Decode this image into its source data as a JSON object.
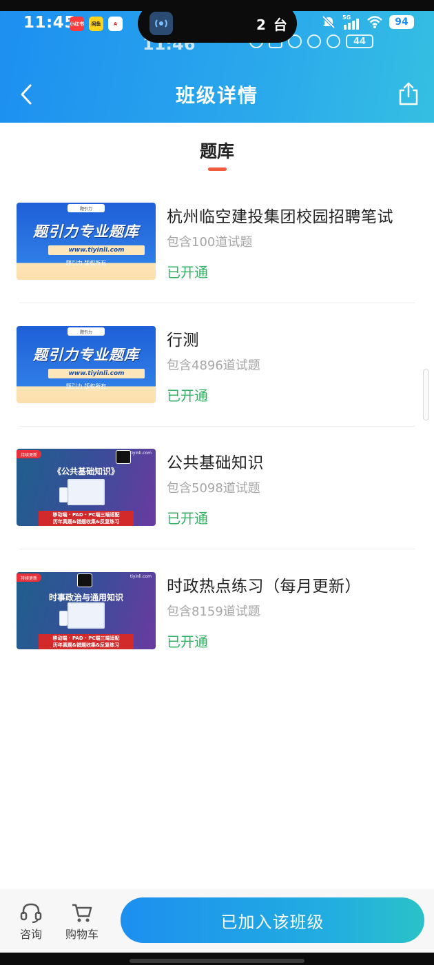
{
  "status_bar": {
    "time": "11:45",
    "app_icons": [
      "小红书",
      "闲鱼",
      "A"
    ],
    "island_count": "2 台",
    "network": "5G",
    "battery": "94",
    "ghost_time": "11:46",
    "ghost_battery": "44"
  },
  "header": {
    "title": "班级详情",
    "back_icon": "chevron-left-icon",
    "share_icon": "share-icon"
  },
  "tab": {
    "label": "题库"
  },
  "banks": [
    {
      "title": "杭州临空建投集团校园招聘笔试",
      "count": "包含100道试题",
      "status": "已开通",
      "thumb": {
        "style": "blue",
        "logo": "题引力",
        "headline": "题引力专业题库",
        "url": "www.tiyinli.com",
        "copyright": "题引力 版权所有"
      }
    },
    {
      "title": "行测",
      "count": "包含4896道试题",
      "status": "已开通",
      "thumb": {
        "style": "blue",
        "logo": "题引力",
        "headline": "题引力专业题库",
        "url": "www.tiyinli.com",
        "copyright": "题引力 版权所有"
      }
    },
    {
      "title": "公共基础知识",
      "count": "包含5098道试题",
      "status": "已开通",
      "thumb": {
        "style": "purple",
        "badge": "持续更新",
        "site": "tiyinli.com",
        "course": "《公共基础知识》",
        "bar_line1": "移动端 · PAD · PC端三端适配",
        "bar_line2": "历年真题&错题收集&反复练习"
      }
    },
    {
      "title": "时政热点练习（每月更新）",
      "count": "包含8159道试题",
      "status": "已开通",
      "thumb": {
        "style": "purple",
        "badge": "持续更新",
        "site": "tiyinli.com",
        "course": "时事政治与通用知识",
        "bar_line1": "移动端 · PAD · PC端三端适配",
        "bar_line2": "历年真题&错题收集&反复练习"
      }
    }
  ],
  "bottom": {
    "consult_label": "咨询",
    "cart_label": "购物车",
    "join_label": "已加入该班级"
  },
  "colors": {
    "header_gradient_start": "#1d8ff0",
    "header_gradient_end": "#35bfe2",
    "status_green": "#33b262",
    "tab_accent": "#ef5b3c"
  }
}
